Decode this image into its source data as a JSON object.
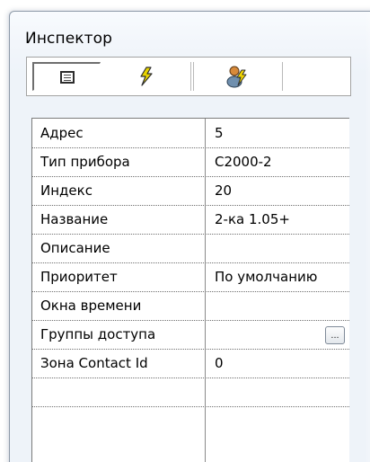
{
  "window": {
    "title": "Инспектор"
  },
  "toolbar": {
    "tabs": [
      {
        "icon": "properties-list-icon",
        "selected": true
      },
      {
        "icon": "lightning-icon",
        "selected": false
      },
      {
        "icon": "user-access-icon",
        "selected": false
      }
    ]
  },
  "properties": {
    "rows": [
      {
        "label": "Адрес",
        "value": "5"
      },
      {
        "label": "Тип прибора",
        "value": "С2000-2"
      },
      {
        "label": "Индекс",
        "value": "20"
      },
      {
        "label": "Название",
        "value": "2-ка 1.05+"
      },
      {
        "label": "Описание",
        "value": ""
      },
      {
        "label": "Приоритет",
        "value": "По умолчанию"
      },
      {
        "label": "Окна времени",
        "value": ""
      },
      {
        "label": "Группы доступа",
        "value": "",
        "button_label": "..."
      },
      {
        "label": "Зона Contact Id",
        "value": "0"
      }
    ]
  },
  "colors": {
    "lightning_icon": "#e8d400",
    "grid_border": "#7b7b7b"
  }
}
